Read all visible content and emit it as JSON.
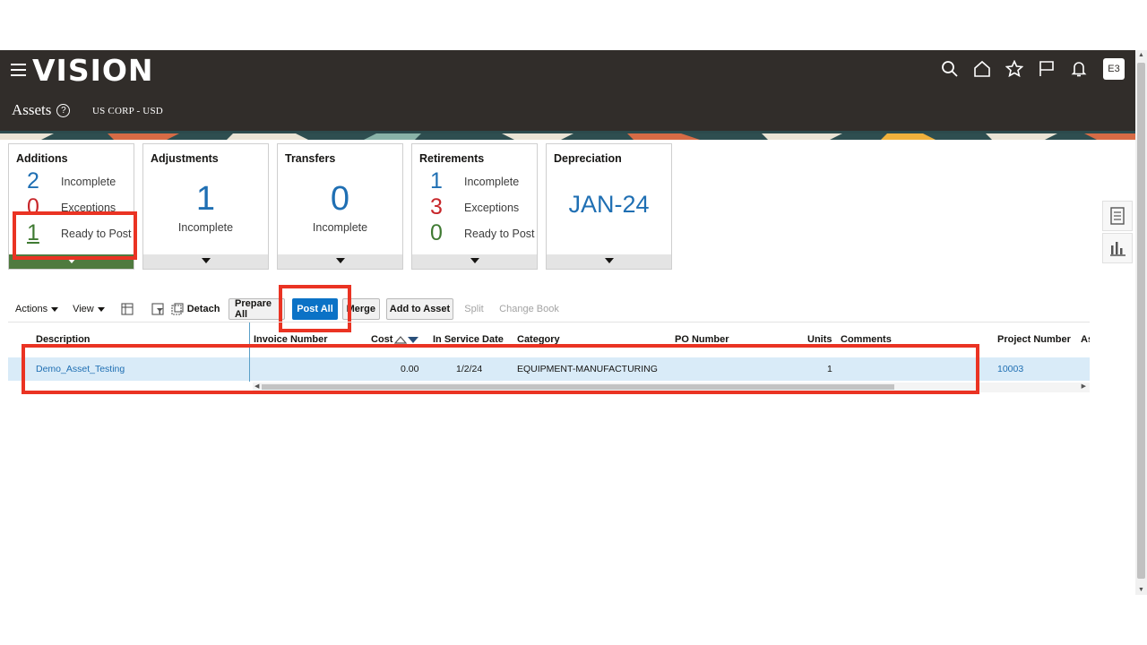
{
  "app": {
    "logo": "VISION",
    "avatar": "E3"
  },
  "page": {
    "title": "Assets",
    "help": "?",
    "subtitle": "US CORP - USD"
  },
  "header_icons": [
    "search-icon",
    "home-icon",
    "star-icon",
    "flag-icon",
    "bell-icon"
  ],
  "tiles": {
    "additions": {
      "title": "Additions",
      "rows": [
        {
          "count": "2",
          "label": "Incomplete"
        },
        {
          "count": "0",
          "label": "Exceptions"
        },
        {
          "count": "1",
          "label": "Ready to Post"
        }
      ]
    },
    "adjustments": {
      "title": "Adjustments",
      "count": "1",
      "label": "Incomplete"
    },
    "transfers": {
      "title": "Transfers",
      "count": "0",
      "label": "Incomplete"
    },
    "retirements": {
      "title": "Retirements",
      "rows": [
        {
          "count": "1",
          "label": "Incomplete"
        },
        {
          "count": "3",
          "label": "Exceptions"
        },
        {
          "count": "0",
          "label": "Ready to Post"
        }
      ]
    },
    "depreciation": {
      "title": "Depreciation",
      "period": "JAN-24"
    }
  },
  "toolbar": {
    "actions": "Actions",
    "view": "View",
    "detach": "Detach",
    "prepare_all": "Prepare All",
    "post_all": "Post All",
    "merge": "Merge",
    "add_to_asset": "Add to Asset",
    "split": "Split",
    "change_book": "Change Book"
  },
  "table": {
    "columns": [
      "Description",
      "Invoice Number",
      "Cost",
      "In Service Date",
      "Category",
      "PO Number",
      "Units",
      "Comments",
      "Project Number",
      "As"
    ],
    "rows": [
      {
        "description": "Demo_Asset_Testing",
        "invoice_number": "",
        "cost": "0.00",
        "in_service_date": "1/2/24",
        "category": "EQUIPMENT-MANUFACTURING",
        "po_number": "",
        "units": "1",
        "comments": "",
        "project_number": "10003"
      }
    ]
  },
  "colors": {
    "header_bg": "#312d2a",
    "accent_blue": "#1f6fb3",
    "primary_button": "#0b72c6",
    "highlight": "#ea3323",
    "row_selected": "#d9ebf8"
  }
}
